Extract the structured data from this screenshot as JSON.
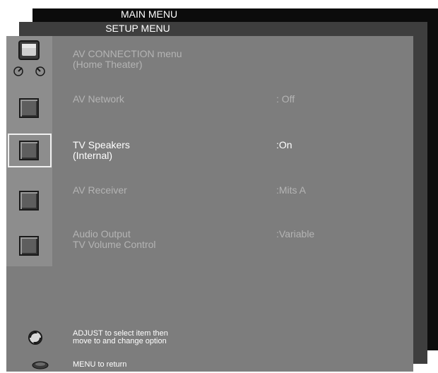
{
  "main_menu": {
    "title": "MAIN MENU"
  },
  "setup_menu": {
    "title": "SETUP MENU"
  },
  "av_menu": {
    "heading_line1": "AV CONNECTION menu",
    "heading_line2": "(Home Theater)",
    "items": [
      {
        "label_line1": "AV Network",
        "label_line2": "",
        "value": ": Off",
        "selected": false
      },
      {
        "label_line1": "TV Speakers",
        "label_line2": "(Internal)",
        "value": ":On",
        "selected": true
      },
      {
        "label_line1": "AV Receiver",
        "label_line2": "",
        "value": ":Mits A",
        "selected": false
      },
      {
        "label_line1": "Audio Output",
        "label_line2": "TV Volume Control",
        "value": ":Variable",
        "selected": false
      }
    ]
  },
  "help": {
    "adjust_line1": "ADJUST to select item then",
    "adjust_line2": "move to and change option",
    "menu_return": "MENU to return"
  },
  "icons": {
    "heading": "tv-with-dials-icon",
    "item": "square-button-icon",
    "adjust": "adjust-knob-icon",
    "menu": "menu-button-icon"
  }
}
